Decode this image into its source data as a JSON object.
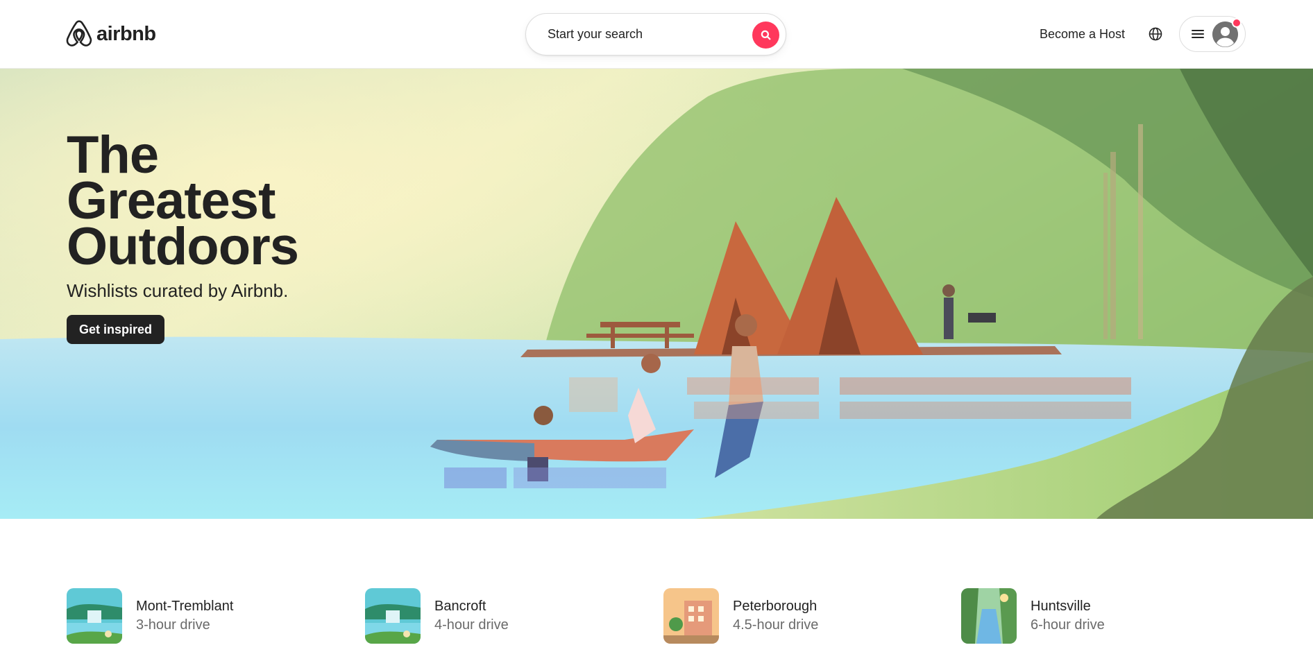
{
  "header": {
    "logo_text": "airbnb",
    "search_placeholder": "Start your search",
    "become_host": "Become a Host"
  },
  "colors": {
    "brand": "#ff385c",
    "text": "#222222",
    "muted": "#6a6a6a"
  },
  "hero": {
    "title": "The\nGreatest\nOutdoors",
    "subtitle": "Wishlists curated by Airbnb.",
    "cta": "Get inspired"
  },
  "destinations": [
    {
      "name": "Mont-Tremblant",
      "drive": "3-hour drive",
      "thumb": "lake-waterfall"
    },
    {
      "name": "Bancroft",
      "drive": "4-hour drive",
      "thumb": "lake-waterfall"
    },
    {
      "name": "Peterborough",
      "drive": "4.5-hour drive",
      "thumb": "town-buildings"
    },
    {
      "name": "Huntsville",
      "drive": "6-hour drive",
      "thumb": "river-forest"
    }
  ],
  "icons": {
    "logo": "airbnb-logo-icon",
    "search": "search-icon",
    "globe": "globe-icon",
    "menu": "hamburger-icon",
    "user": "user-avatar-icon"
  }
}
